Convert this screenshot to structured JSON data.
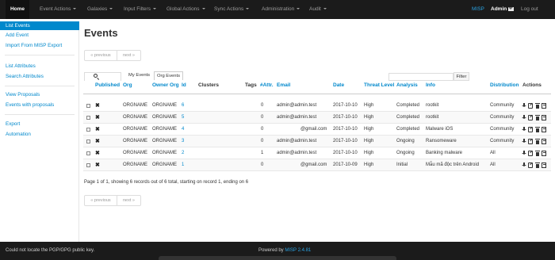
{
  "navbar": {
    "home": "Home",
    "menus": [
      "Event Actions",
      "Galaxies",
      "Input Filters",
      "Global Actions",
      "Sync Actions",
      "Administration",
      "Audit"
    ],
    "brand": "MISP",
    "user": "Admin",
    "logout": "Log out"
  },
  "sidebar": {
    "items": [
      "List Events",
      "Add Event",
      "Import From MISP Export",
      "List Attributes",
      "Search Attributes",
      "View Proposals",
      "Events with proposals",
      "Export",
      "Automation"
    ]
  },
  "main": {
    "title": "Events",
    "pager": {
      "previous": "« previous",
      "next": "next »"
    },
    "tabs": [
      "My Events",
      "Org Events"
    ],
    "filter_label": "Filter"
  },
  "table": {
    "headers": {
      "published": "Published",
      "org": "Org",
      "owner_org": "Owner Org",
      "id": "Id",
      "clusters": "Clusters",
      "tags": "Tags",
      "attr_count": "#Attr.",
      "email": "Email",
      "date": "Date",
      "threat_level": "Threat Level",
      "analysis": "Analysis",
      "info": "Info",
      "distribution": "Distribution",
      "actions": "Actions"
    },
    "rows": [
      {
        "org": "ORGNAME",
        "owner_org": "ORGNAME",
        "id": "6",
        "attr": "0",
        "email": "admin@admin.test",
        "date": "2017-10-10",
        "threat": "High",
        "analysis": "Completed",
        "info": "rootkit",
        "distribution": "Community"
      },
      {
        "org": "ORGNAME",
        "owner_org": "ORGNAME",
        "id": "5",
        "attr": "0",
        "email": "admin@admin.test",
        "date": "2017-10-10",
        "threat": "High",
        "analysis": "Completed",
        "info": "rootkit",
        "distribution": "Community"
      },
      {
        "org": "ORGNAME",
        "owner_org": "ORGNAME",
        "id": "4",
        "attr": "0",
        "email": "@gmail.com",
        "date": "2017-10-10",
        "threat": "High",
        "analysis": "Completed",
        "info": "Malware iOS",
        "distribution": "Community"
      },
      {
        "org": "ORGNAME",
        "owner_org": "ORGNAME",
        "id": "3",
        "attr": "0",
        "email": "admin@admin.test",
        "date": "2017-10-10",
        "threat": "High",
        "analysis": "Ongoing",
        "info": "Ransomeware",
        "distribution": "Community"
      },
      {
        "org": "ORGNAME",
        "owner_org": "ORGNAME",
        "id": "2",
        "attr": "1",
        "email": "admin@admin.test",
        "date": "2017-10-10",
        "threat": "High",
        "analysis": "Ongoing",
        "info": "Banking malware",
        "distribution": "All"
      },
      {
        "org": "ORGNAME",
        "owner_org": "ORGNAME",
        "id": "1",
        "attr": "0",
        "email": "@gmail.com",
        "date": "2017-10-09",
        "threat": "High",
        "analysis": "Initial",
        "info": "Mẫu mã độc trên Android",
        "distribution": "All"
      }
    ]
  },
  "summary": "Page 1 of 1, showing 6 records out of 6 total, starting on record 1, ending on 6",
  "footer": {
    "pgp_warning": "Could not locate the PGP/GPG public key.",
    "powered_by": "Powered by",
    "version": "MISP 2.4.81"
  }
}
